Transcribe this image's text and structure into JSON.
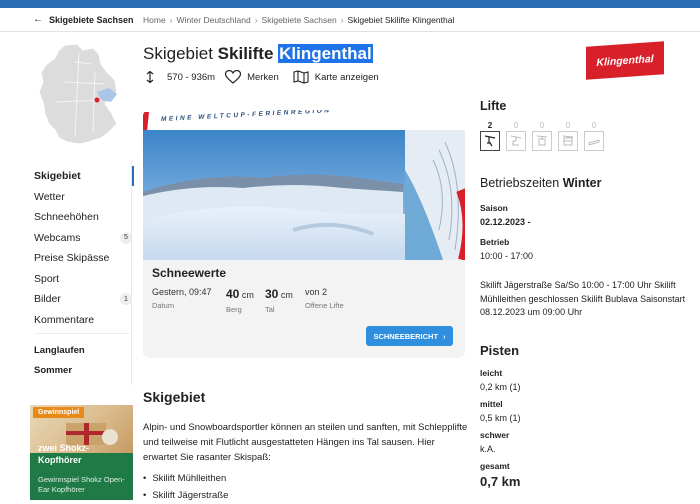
{
  "header": {
    "back_label": "Skigebiete Sachsen",
    "breadcrumbs": [
      "Home",
      "Winter Deutschland",
      "Skigebiete Sachsen",
      "Skigebiet Skilifte Klingenthal"
    ]
  },
  "title": {
    "prefix": "Skigebiet",
    "bold": "Skilifte",
    "highlight": "Klingenthal"
  },
  "meta": {
    "altitude": "570 - 936m",
    "save_label": "Merken",
    "map_label": "Karte anzeigen"
  },
  "logo_text": "Klingenthal",
  "nav": {
    "items": [
      {
        "label": "Skigebiet",
        "badge": ""
      },
      {
        "label": "Wetter",
        "badge": ""
      },
      {
        "label": "Schneehöhen",
        "badge": ""
      },
      {
        "label": "Webcams",
        "badge": "5"
      },
      {
        "label": "Preise Skipässe",
        "badge": ""
      },
      {
        "label": "Sport",
        "badge": ""
      },
      {
        "label": "Bilder",
        "badge": "1"
      },
      {
        "label": "Kommentare",
        "badge": ""
      }
    ],
    "secondary": [
      "Langlaufen",
      "Sommer"
    ]
  },
  "promo": {
    "tag": "Gewinnspiel",
    "title": "zwei Shokz-Kopfhörer",
    "subtitle": "Gewinnspiel Shokz Open-Ear Kopfhörer"
  },
  "banner": {
    "slogan": "MEINE WELTCUP-FERIENREGION"
  },
  "snow": {
    "title": "Schneewerte",
    "date": "Gestern, 09:47",
    "date_label": "Datum",
    "mountain": "40",
    "mountain_unit": "cm",
    "mountain_label": "Berg",
    "valley": "30",
    "valley_unit": "cm",
    "valley_label": "Tal",
    "open_lifts": "von 2",
    "open_lifts_label": "Offene Lifte",
    "button": "SCHNEEBERICHT"
  },
  "skigebiet": {
    "heading": "Skigebiet",
    "text": "Alpin- und Snowboardsportler können an steilen und sanften, mit Schlepplifte und teilweise mit Flutlicht ausgestatteten Hängen ins Tal sausen. Hier erwartet Sie rasanter Skispaß:",
    "lifts": [
      "Skilift Mühlleithen",
      "Skilift Jägerstraße"
    ]
  },
  "right": {
    "lifts_heading": "Lifte",
    "lift_counts": [
      "2",
      "0",
      "0",
      "0",
      "0"
    ],
    "lift_icons": [
      "t-bar-icon",
      "chairlift-icon",
      "gondola-icon",
      "cable-car-icon",
      "magic-carpet-icon"
    ],
    "hours_heading": "Betriebszeiten",
    "hours_season": "Winter",
    "saison_label": "Saison",
    "saison_value": "02.12.2023 -",
    "betrieb_label": "Betrieb",
    "betrieb_value": "10:00 - 17:00",
    "notes": "Skilift Jägerstraße Sa/So 10:00 - 17:00 Uhr Skilift Mühlleithen geschlossen Skilift Bublava Saisonstart 08.12.2023 um 09:00 Uhr",
    "pisten_heading": "Pisten",
    "pisten": [
      {
        "label": "leicht",
        "value": "0,2 km (1)"
      },
      {
        "label": "mittel",
        "value": "0,5 km (1)"
      },
      {
        "label": "schwer",
        "value": "k.A."
      }
    ],
    "total_label": "gesamt",
    "total_value": "0,7 km"
  },
  "colors": {
    "accent": "#2a6db5",
    "button": "#2f8fde",
    "logo": "#d8202a",
    "promo": "#1f7a46"
  }
}
